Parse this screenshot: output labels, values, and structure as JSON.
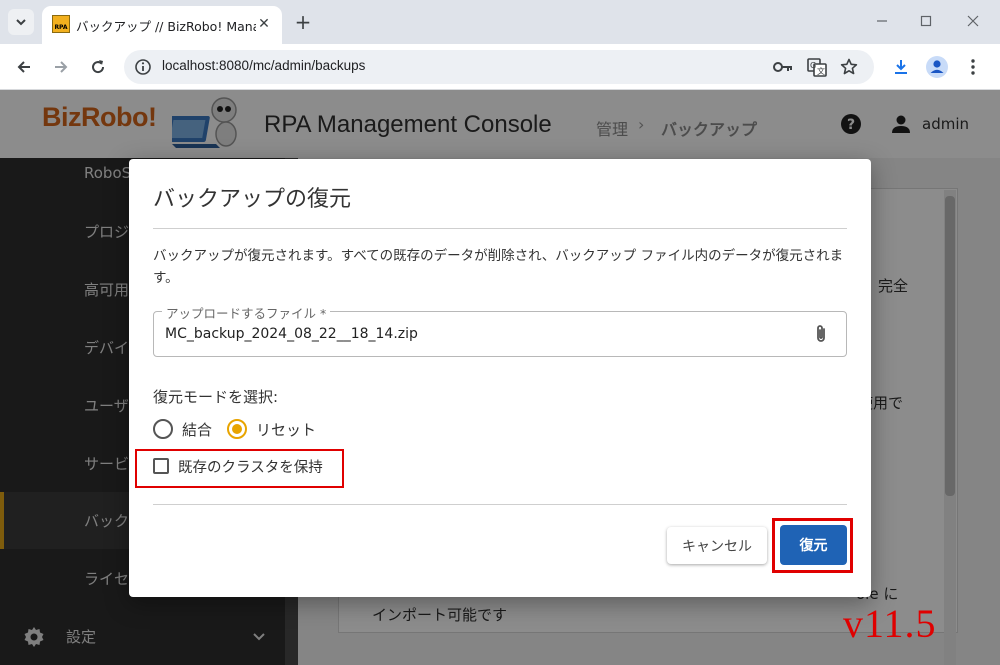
{
  "browser": {
    "tab_title": "バックアップ // BizRobo! Managemer",
    "favicon_text": "RPA",
    "url": "localhost:8080/mc/admin/backups"
  },
  "header": {
    "logo_text": "BizRobo!",
    "app_title": "RPA Management Console",
    "breadcrumb": [
      "管理",
      "バックアップ"
    ],
    "user": "admin"
  },
  "sidebar": {
    "items": [
      {
        "label": "RoboSe"
      },
      {
        "label": "プロジ"
      },
      {
        "label": "高可用性"
      },
      {
        "label": "デバイス"
      },
      {
        "label": "ユーザ"
      },
      {
        "label": "サービ"
      },
      {
        "label": "バック"
      },
      {
        "label": "ライセ"
      }
    ],
    "settings_label": "設定"
  },
  "background_text": {
    "frag_1": "完全",
    "frag_2": "使用で",
    "frag_3": "ole に",
    "frag_4": "インポート可能です"
  },
  "dialog": {
    "title": "バックアップの復元",
    "description": "バックアップが復元されます。すべての既存のデータが削除され、バックアップ ファイル内のデータが復元されます。",
    "file_label": "アップロードするファイル *",
    "file_value": "MC_backup_2024_08_22__18_14.zip",
    "mode_label": "復元モードを選択:",
    "modes": [
      {
        "label": "結合",
        "selected": false
      },
      {
        "label": "リセット",
        "selected": true
      }
    ],
    "keep_cluster_label": "既存のクラスタを保持",
    "keep_cluster_checked": false,
    "cancel_label": "キャンセル",
    "restore_label": "復元"
  },
  "annotation": {
    "version": "v11.5",
    "highlight_color": "#e00000"
  },
  "colors": {
    "accent": "#e8a400",
    "primary_button": "#1f63b5",
    "logo": "#d4641a",
    "sidebar": "#2e2e2e"
  }
}
